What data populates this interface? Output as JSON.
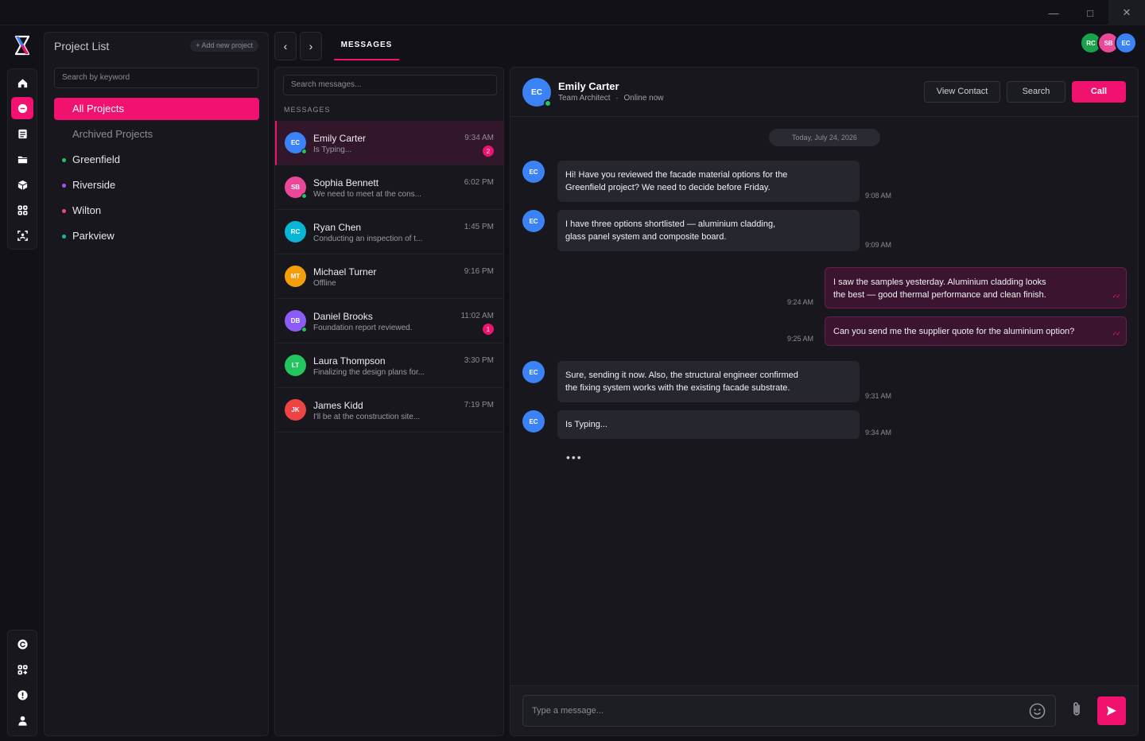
{
  "window": {
    "minimize_glyph": "—",
    "maximize_glyph": "□",
    "close_glyph": "✕"
  },
  "rail": {
    "top_icons": [
      "home-icon",
      "chat-icon",
      "list-icon",
      "folder-icon",
      "cube-icon",
      "grid-icon",
      "scan-face-icon"
    ],
    "bottom_icons": [
      "refresh-icon",
      "grid-plus-icon",
      "alert-icon",
      "user-icon"
    ]
  },
  "projects": {
    "title": "Project List",
    "add_label": "+ Add new project",
    "search_placeholder": "Search by keyword",
    "tabs": [
      {
        "label": "All Projects"
      },
      {
        "label": "Archived Projects"
      }
    ],
    "items": [
      {
        "label": "Greenfield",
        "color": "#22c55e"
      },
      {
        "label": "Riverside",
        "color": "#a855f7"
      },
      {
        "label": "Wilton",
        "color": "#ec4899"
      },
      {
        "label": "Parkview",
        "color": "#14b8a6"
      }
    ]
  },
  "nav": {
    "back": "‹",
    "forward": "›",
    "tab_label": "MESSAGES"
  },
  "top_avatars": [
    {
      "initials": "RC",
      "color": "#16a34a"
    },
    {
      "initials": "SB",
      "color": "#ec4899"
    },
    {
      "initials": "EC",
      "color": "#3b82f6"
    }
  ],
  "messages_panel": {
    "search_placeholder": "Search messages...",
    "heading": "MESSAGES",
    "conversations": [
      {
        "initials": "EC",
        "name": "Emily Carter",
        "preview": "Is Typing...",
        "time": "9:34 AM",
        "badge": "2",
        "online": true,
        "color": "#3b82f6"
      },
      {
        "initials": "SB",
        "name": "Sophia Bennett",
        "preview": "We need to meet at the cons...",
        "time": "6:02 PM",
        "badge": "",
        "online": true,
        "color": "#ec4899"
      },
      {
        "initials": "RC",
        "name": "Ryan Chen",
        "preview": "Conducting an inspection of t...",
        "time": "1:45 PM",
        "badge": "",
        "online": false,
        "color": "#06b6d4"
      },
      {
        "initials": "MT",
        "name": "Michael Turner",
        "preview": "Offline",
        "time": "9:16 PM",
        "badge": "",
        "online": false,
        "color": "#f59e0b"
      },
      {
        "initials": "DB",
        "name": "Daniel Brooks",
        "preview": "Foundation report reviewed.",
        "time": "11:02 AM",
        "badge": "1",
        "online": true,
        "color": "#8b5cf6"
      },
      {
        "initials": "LT",
        "name": "Laura Thompson",
        "preview": "Finalizing the design plans for...",
        "time": "3:30 PM",
        "badge": "",
        "online": false,
        "color": "#22c55e"
      },
      {
        "initials": "JK",
        "name": "James Kidd",
        "preview": "I'll be at the construction site...",
        "time": "7:19 PM",
        "badge": "",
        "online": false,
        "color": "#ef4444"
      }
    ]
  },
  "chat": {
    "contact": {
      "initials": "EC",
      "name": "Emily Carter",
      "role": "Team Architect",
      "separator": "·",
      "status": "Online now"
    },
    "buttons": {
      "view_contact": "View Contact",
      "search": "Search",
      "call": "Call"
    },
    "date_label": "Today, July 24, 2026",
    "messages": [
      {
        "dir": "in",
        "line1": "Hi! Have you reviewed the facade material options for the",
        "line2": "Greenfield project? We need to decide before Friday.",
        "time": "9:08 AM"
      },
      {
        "dir": "in",
        "line1": "I have three options shortlisted — aluminium cladding,",
        "line2": "glass panel system and composite board.",
        "time": "9:09 AM"
      },
      {
        "dir": "out",
        "line1": "I saw the samples yesterday. Aluminium cladding looks",
        "line2": "the best — good thermal performance and clean finish.",
        "time": "9:24 AM"
      },
      {
        "dir": "out",
        "line1": "Can you send me the supplier quote for the aluminium option?",
        "line2": "",
        "time": "9:25 AM"
      },
      {
        "dir": "in",
        "line1": "Sure, sending it now. Also, the structural engineer confirmed",
        "line2": "the fixing system works with the existing facade substrate.",
        "time": "9:31 AM"
      },
      {
        "dir": "in",
        "line1": "Is Typing...",
        "line2": "",
        "time": "9:34 AM"
      }
    ],
    "typing_indicator": "•••",
    "read_ticks": "✓✓",
    "composer_placeholder": "Type a message..."
  }
}
